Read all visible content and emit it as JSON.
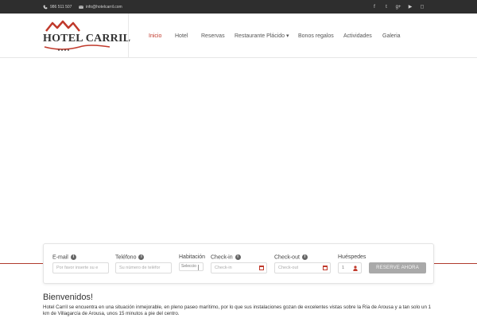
{
  "topbar": {
    "phone": "986 511 507",
    "email": "info@hotelcarril.com",
    "social_icons": [
      "facebook-icon",
      "twitter-icon",
      "google-plus-icon",
      "youtube-icon",
      "instagram-icon"
    ]
  },
  "header": {
    "logo_text": "HOTEL CARRIL",
    "nav": [
      {
        "label": "Inicio",
        "active": true
      },
      {
        "label": "Hotel"
      },
      {
        "label": "Reservas"
      },
      {
        "label": "Restaurante Plácido ▾"
      },
      {
        "label": "Bonos regalos"
      },
      {
        "label": "Actividades"
      },
      {
        "label": "Galeria"
      }
    ]
  },
  "booking": {
    "email_label": "E-mail",
    "email_placeholder": "Por favor inserte su e",
    "phone_label": "Teléfono",
    "phone_placeholder": "Su número de teléfor",
    "room_label": "Habitación",
    "room_value": "Seleccio",
    "checkin_label": "Check-in",
    "checkin_placeholder": "Check-in",
    "checkout_label": "Check-out",
    "checkout_placeholder": "Check-out",
    "guests_label": "Huéspedes",
    "guests_value": "1",
    "reserve_label": "RESERVE AHORA"
  },
  "welcome": {
    "title": "Bienvenidos!",
    "text": "Hotel Carril se encuentra en una situación inmejorable, en pleno paseo marítimo, por lo que sus instalaciones gozan de excelentes vistas sobre la Ría de Arousa y a tan solo un 1 km de Villagarcía de Arousa, unos 15 minutos a pie del centro."
  },
  "colors": {
    "accent": "#c0392b",
    "topbar_bg": "#2e2e2e",
    "button_bg": "#a9a9a9"
  }
}
